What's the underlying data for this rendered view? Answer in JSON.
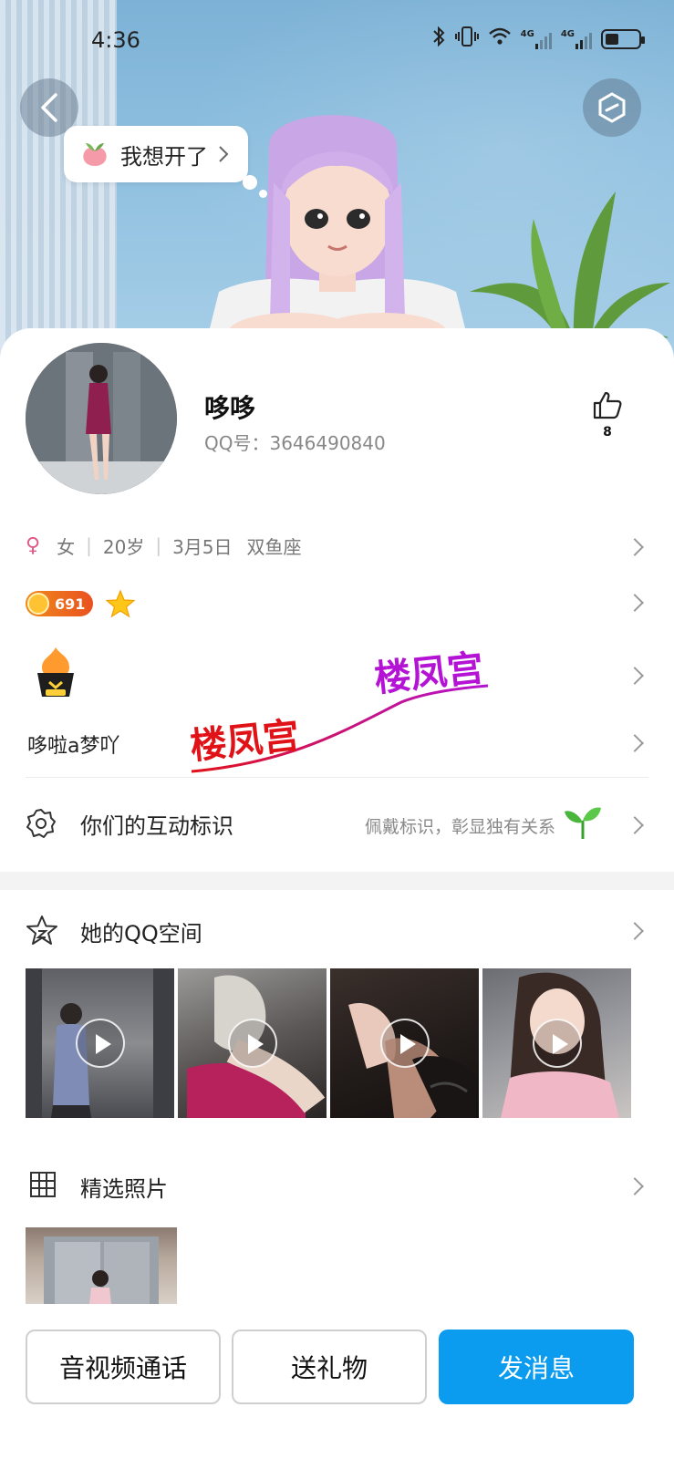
{
  "status_bar": {
    "time": "4:36",
    "network_1": "4G",
    "network_2": "4G"
  },
  "banner": {
    "bubble_text": "我想开了"
  },
  "profile": {
    "nickname": "哆哆",
    "qq_label": "QQ号：",
    "qq_number": "3646490840",
    "like_count": "8"
  },
  "info": {
    "gender": "女",
    "age": "20岁",
    "birthday": "3月5日",
    "zodiac": "双鱼座"
  },
  "level": {
    "value": "691"
  },
  "signature": "哆啦a梦吖",
  "watermark": {
    "text_1": "楼凤宫",
    "text_2": "楼凤宫"
  },
  "interaction": {
    "label": "你们的互动标识",
    "hint": "佩戴标识，彰显独有关系"
  },
  "qzone": {
    "title": "她的QQ空间"
  },
  "photos": {
    "title": "精选照片"
  },
  "actions": {
    "call": "音视频通话",
    "gift": "送礼物",
    "message": "发消息"
  },
  "colors": {
    "accent": "#0B9CF0",
    "gender": "#E05A88",
    "level": "#E9511F"
  }
}
